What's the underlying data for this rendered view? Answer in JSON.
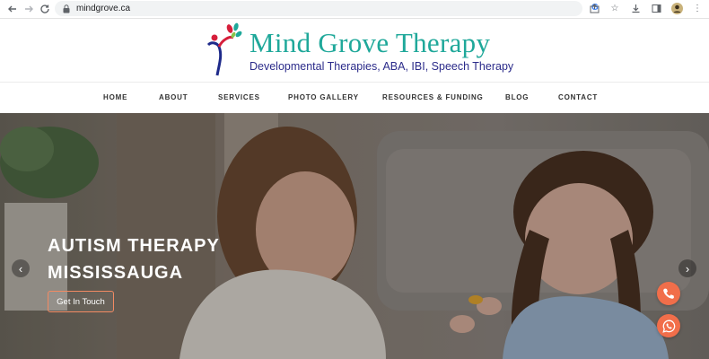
{
  "browser": {
    "url": "mindgrove.ca",
    "icons": [
      "back-icon",
      "forward-icon",
      "reload-icon",
      "lock-icon",
      "google-icon",
      "share-icon",
      "bookmark-icon",
      "download-icon",
      "sidebar-icon",
      "profile-icon",
      "menu-icon"
    ]
  },
  "site": {
    "brand": "Mind Grove Therapy",
    "tagline": "Developmental Therapies, ABA, IBI, Speech Therapy"
  },
  "nav": {
    "items": [
      "HOME",
      "ABOUT",
      "SERVICES",
      "PHOTO GALLERY",
      "RESOURCES & FUNDING",
      "BLOG",
      "CONTACT"
    ]
  },
  "hero": {
    "title_line1": "AUTISM THERAPY",
    "title_line2": "MISSISSAUGA",
    "cta_label": "Get In Touch",
    "prev_glyph": "‹",
    "next_glyph": "›"
  },
  "colors": {
    "brand_teal": "#1fa89a",
    "tagline_navy": "#2b2b8a",
    "accent_orange": "#f16e4a"
  }
}
